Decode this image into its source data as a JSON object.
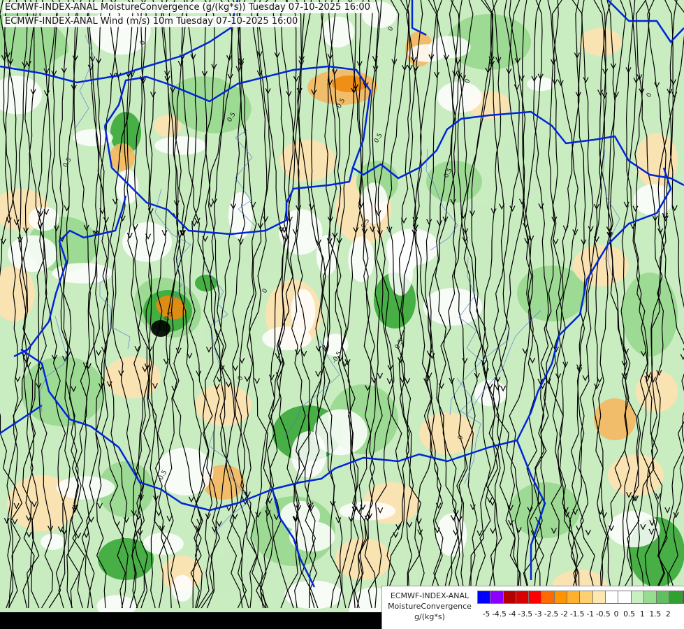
{
  "titles": {
    "line1": "ECMWF-INDEX-ANAL MoistureConvergence (g/(kg*s)) Tuesday 07-10-2025 16:00",
    "line2": "ECMWF-INDEX-ANAL Wind (m/s) 10m Tuesday 07-10-2025 16:00"
  },
  "legend": {
    "line1": "ECMWF-INDEX-ANAL",
    "line2": "MoistureConvergence",
    "units": "g/(kg*s)",
    "swatch_colors": [
      "#0000ff",
      "#8a00ff",
      "#b40000",
      "#d80000",
      "#ff0000",
      "#ff6a00",
      "#ff9400",
      "#ffb030",
      "#ffd070",
      "#ffe8b0",
      "#ffffff",
      "#ffffff",
      "#c8f0c0",
      "#98dc90",
      "#60c060",
      "#30a030",
      "#009000"
    ],
    "ticks": [
      "-5",
      "-4.5",
      "-4",
      "-3.5",
      "-3",
      "-2.5",
      "-2",
      "-1.5",
      "-1",
      "-0.5",
      "0",
      "0.5",
      "1",
      "1.5",
      "2"
    ]
  },
  "map": {
    "contour_labels": [
      "0",
      "0.5",
      "-0.5",
      "0",
      "0.5",
      "0",
      "-0.5",
      "0.5",
      "0",
      "0.5",
      "-0.5",
      "0",
      "0.5",
      "0",
      "-0.5",
      "0.5",
      "0"
    ]
  },
  "colors": {
    "border": "#0026d6",
    "streamline": "#000000",
    "green_light": "#c8ecc0",
    "green_mid": "#98d88e",
    "green_dark": "#3aa83a",
    "orange_light": "#ffe2b0",
    "orange_mid": "#f5b860",
    "orange_dark": "#f08a10"
  }
}
